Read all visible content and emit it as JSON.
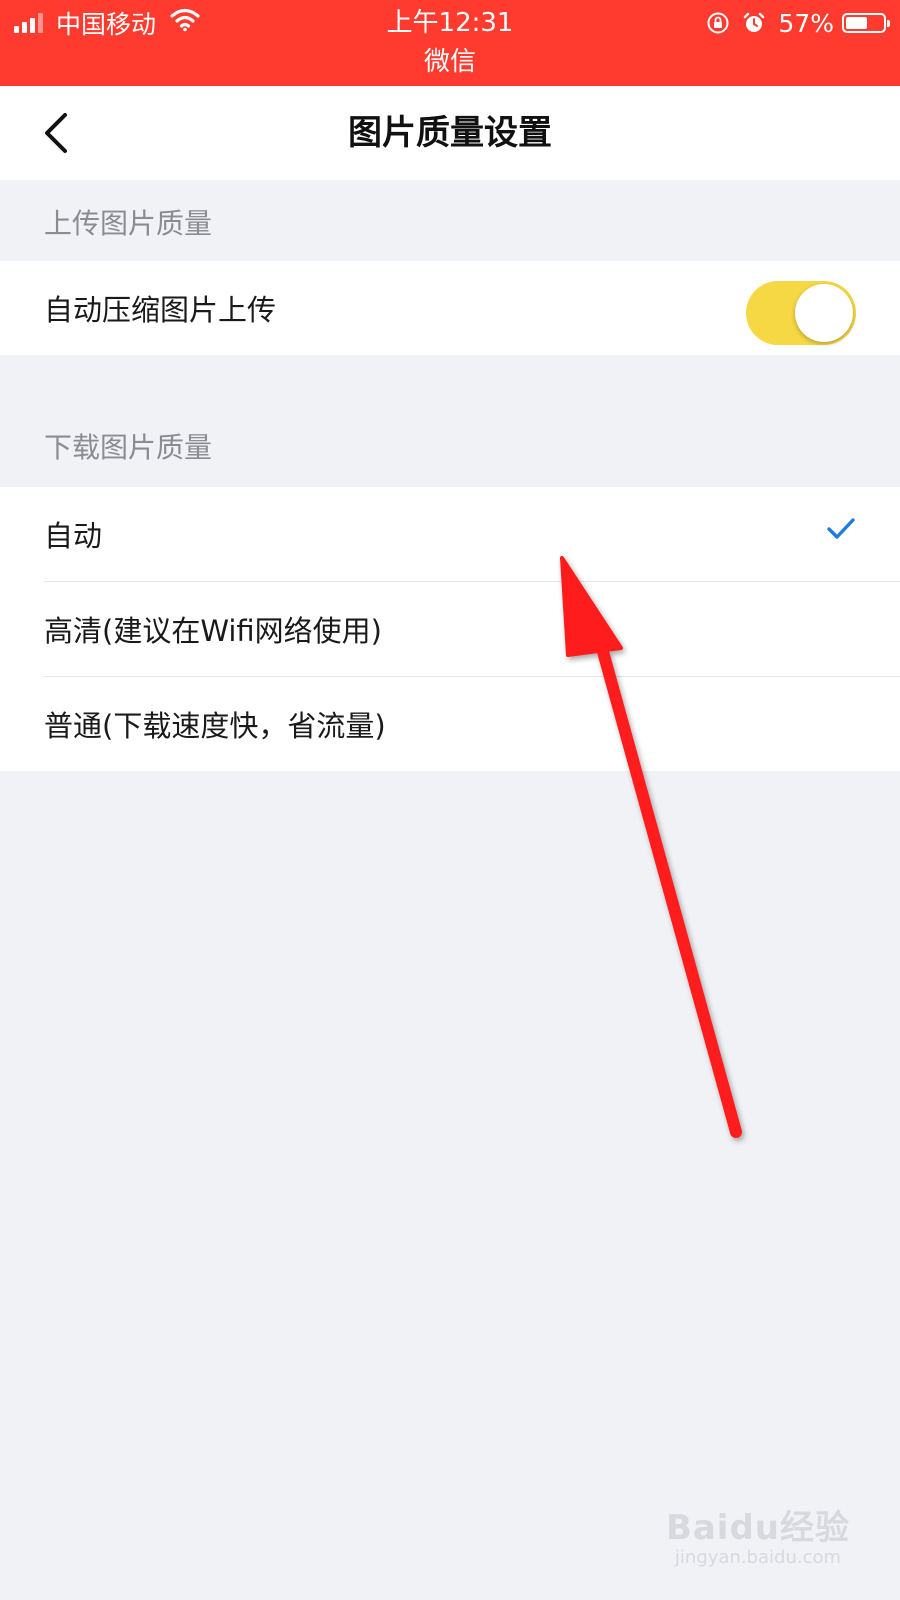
{
  "status_bar": {
    "carrier": "中国移动",
    "time": "上午12:31",
    "app": "微信",
    "battery_percent": "57%",
    "battery_level": 0.57,
    "color": "#ff3b30"
  },
  "nav": {
    "title": "图片质量设置",
    "back_icon": "chevron-left-icon"
  },
  "upload_section": {
    "header": "上传图片质量",
    "items": [
      {
        "label": "自动压缩图片上传",
        "toggle_on": true,
        "toggle_color": "#f5d844"
      }
    ]
  },
  "download_section": {
    "header": "下载图片质量",
    "options": [
      {
        "label": "自动",
        "selected": true
      },
      {
        "label": "高清(建议在Wifi网络使用)",
        "selected": false
      },
      {
        "label": "普通(下载速度快，省流量)",
        "selected": false
      }
    ],
    "check_color": "#1e7be0"
  },
  "annotation": {
    "arrow_color": "#ff1a1a"
  },
  "watermark": {
    "main": "Baidu经验",
    "sub": "jingyan.baidu.com"
  }
}
